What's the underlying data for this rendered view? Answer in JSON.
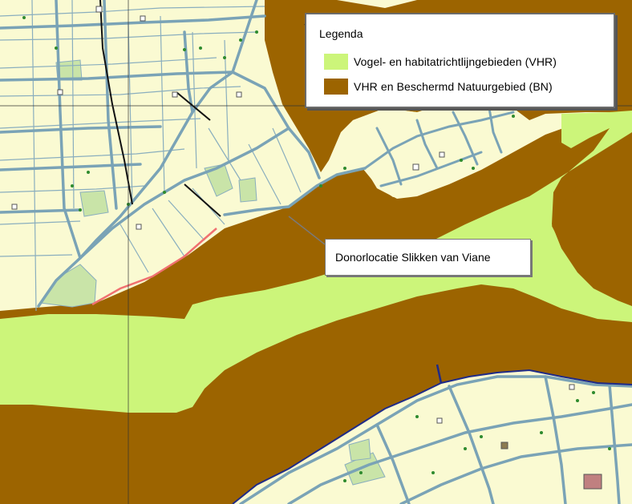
{
  "legend": {
    "title": "Legenda",
    "items": [
      {
        "label": "Vogel- en habitatrichtlijngebieden (VHR)",
        "color": "#ccf57a"
      },
      {
        "label": "VHR en Beschermd Natuurgebied (BN)",
        "color": "#9c6400"
      }
    ]
  },
  "callout": {
    "label": "Donorlocatie Slikken van Viane"
  },
  "colors": {
    "land": "#fafad2",
    "water_vhr_bn": "#9c6400",
    "vhr_light": "#ccf57a",
    "road": "#7aa3b6",
    "parcel_line": "#8aaebe",
    "shoreline": "#1f2a88",
    "donor_shore": "#f07070",
    "vegetation": "#2e8b2e"
  }
}
